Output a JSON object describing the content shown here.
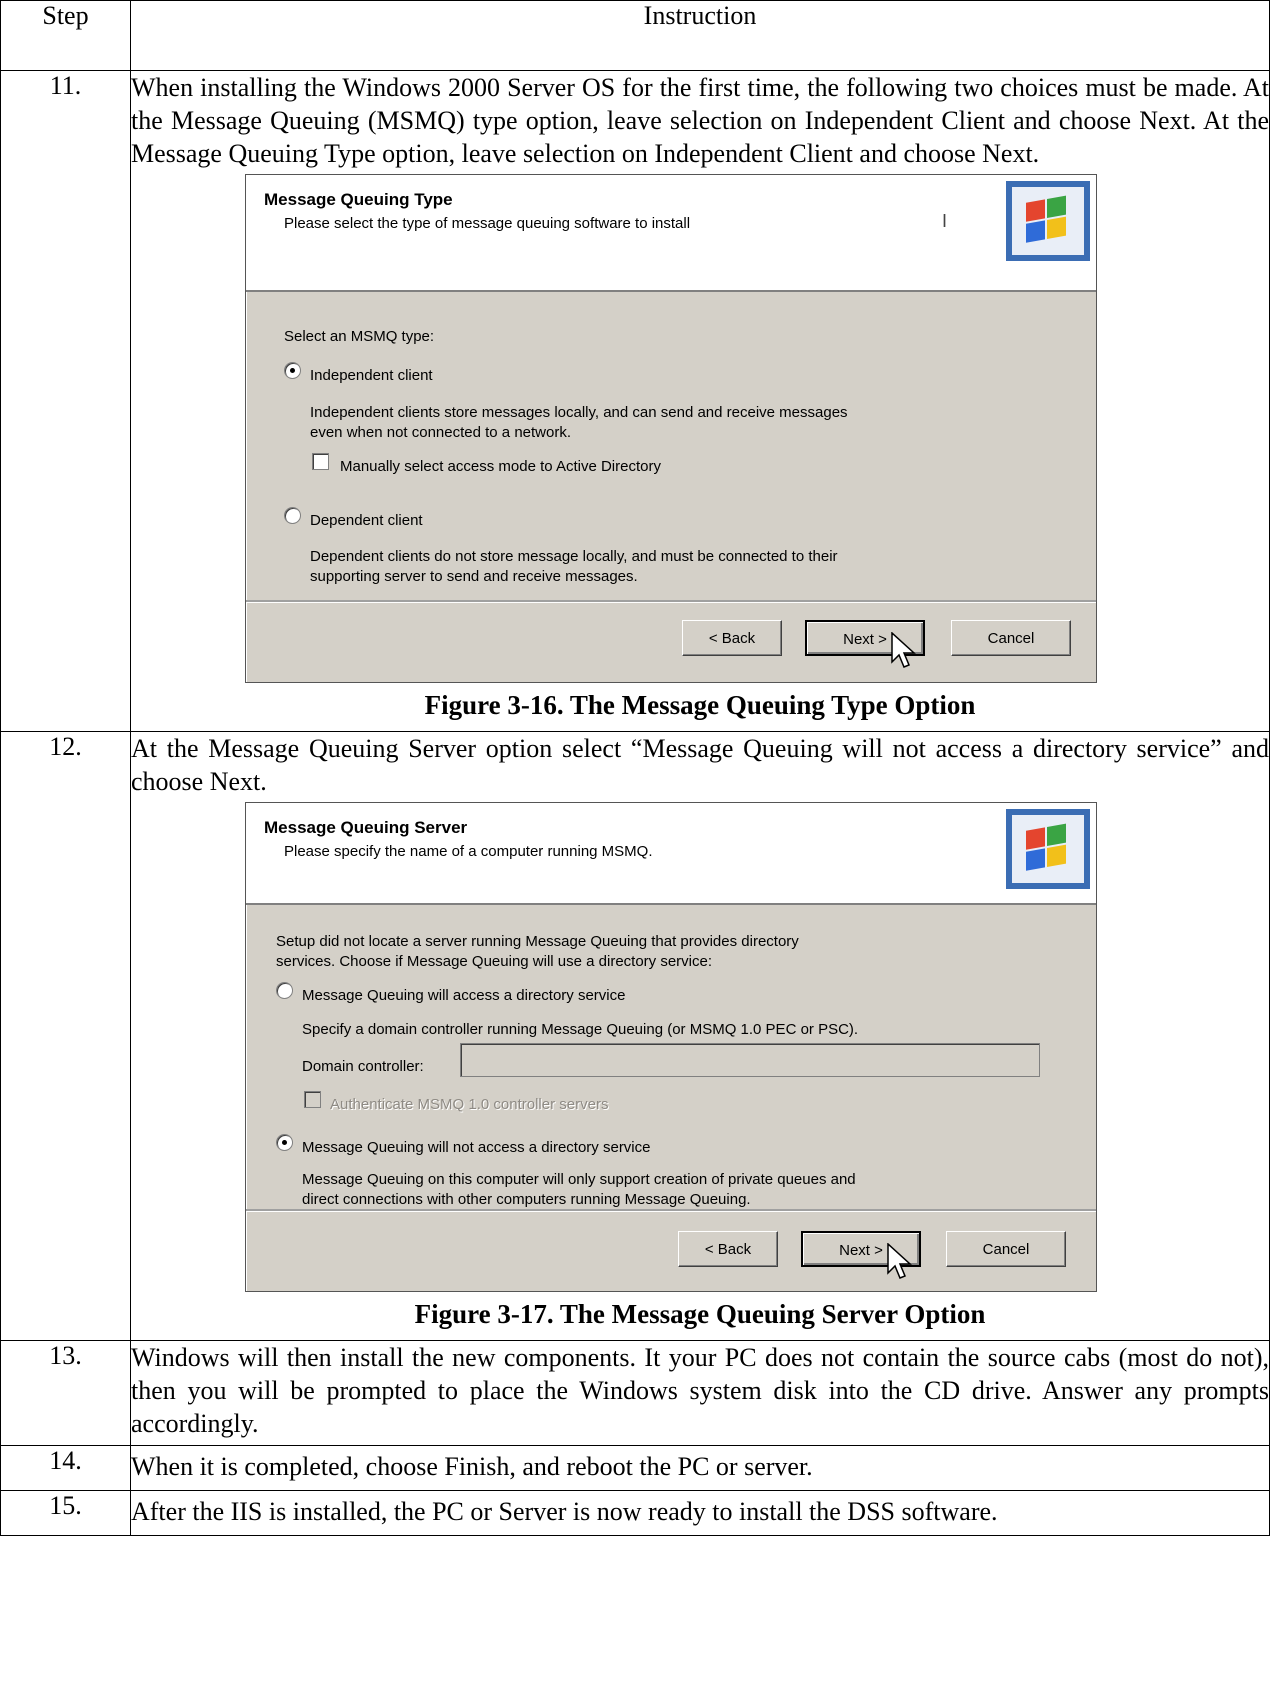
{
  "table": {
    "header_step": "Step",
    "header_instruction": "Instruction"
  },
  "steps": [
    {
      "number": "11.",
      "text": "When installing the Windows 2000 Server OS for the first time, the following two choices must be made.  At the Message Queuing (MSMQ) type option, leave selection on Independent Client and choose Next.  At the Message Queuing Type option, leave selection on Independent Client and choose Next.",
      "figure_caption": "Figure 3-16.  The Message Queuing Type Option"
    },
    {
      "number": "12.",
      "text": "At the Message Queuing Server option select “Message Queuing will not access a directory service” and choose Next.",
      "figure_caption": "Figure 3-17.  The Message Queuing Server Option"
    },
    {
      "number": "13.",
      "text": "Windows will then install the new components.  It your PC does not contain the source cabs (most do not), then you will be prompted to place the Windows system disk into the CD drive.  Answer any prompts accordingly."
    },
    {
      "number": "14.",
      "text": "When it is completed, choose Finish, and reboot the PC or server."
    },
    {
      "number": "15.",
      "text": "After the IIS is installed, the PC or Server is now ready to install the DSS software."
    }
  ],
  "dialog_type": {
    "title": "Message Queuing Type",
    "subtitle": "Please select the type of message queuing software to install",
    "cursor_glyph": "I",
    "prompt": "Select an MSMQ type:",
    "option_independent": "Independent client",
    "option_independent_desc_1": "Independent clients store messages locally, and can send and receive messages",
    "option_independent_desc_2": "even when not connected to a network.",
    "checkbox_manual": "Manually select access mode to Active Directory",
    "option_dependent": "Dependent client",
    "option_dependent_desc_1": "Dependent clients do not store message locally, and must be connected to their",
    "option_dependent_desc_2": "supporting server to send and receive messages.",
    "selected_option": "Independent client",
    "back_label": "< Back",
    "next_label": "Next >",
    "cancel_label": "Cancel"
  },
  "dialog_server": {
    "title": "Message Queuing Server",
    "subtitle": "Please specify the name of a computer running MSMQ.",
    "intro_1": "Setup did not locate a server running Message Queuing that provides directory",
    "intro_2": "services. Choose if Message Queuing will use a directory service:",
    "option_access": "Message Queuing will access a directory service",
    "option_access_desc": "Specify a domain controller running Message Queuing (or MSMQ 1.0 PEC or PSC).",
    "domain_label": "Domain controller:",
    "domain_value": "",
    "checkbox_auth": "Authenticate MSMQ 1.0 controller servers",
    "option_no_access": "Message Queuing will not access a directory service",
    "option_no_access_desc_1": "Message Queuing on this computer will only support creation of private queues and",
    "option_no_access_desc_2": "direct connections with other computers running Message Queuing.",
    "selected_option": "Message Queuing will not access a directory service",
    "back_label": "< Back",
    "next_label": "Next >",
    "cancel_label": "Cancel"
  },
  "icons": {
    "dialog_logo": "windows-flag-icon",
    "pointer": "mouse-pointer-icon"
  },
  "colors": {
    "dialog_face": "#d4d0c8",
    "logo_frame": "#3b6db4"
  }
}
